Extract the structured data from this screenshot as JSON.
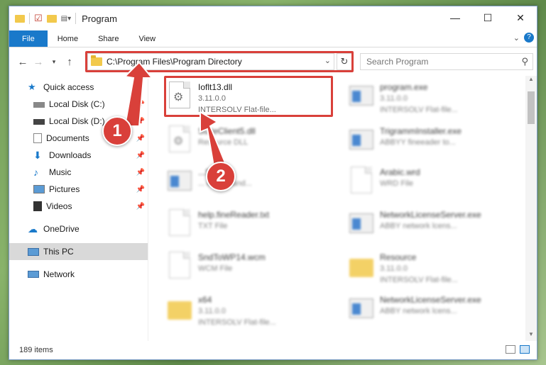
{
  "window": {
    "title": "Program",
    "controls": {
      "minimize": "—",
      "maximize": "☐",
      "close": "✕"
    }
  },
  "ribbon": {
    "tabs": [
      "File",
      "Home",
      "Share",
      "View"
    ]
  },
  "address": {
    "path": "C:\\Program Files\\Program Directory"
  },
  "search": {
    "placeholder": "Search Program"
  },
  "nav": {
    "items": [
      {
        "label": "Quick access"
      },
      {
        "label": "Local Disk (C:)"
      },
      {
        "label": "Local Disk (D:)"
      },
      {
        "label": "Documents"
      },
      {
        "label": "Downloads"
      },
      {
        "label": "Music"
      },
      {
        "label": "Pictures"
      },
      {
        "label": "Videos"
      },
      {
        "label": "OneDrive"
      },
      {
        "label": "This PC"
      },
      {
        "label": "Network"
      }
    ]
  },
  "files": [
    {
      "name": "Ioflt13.dll",
      "line2": "3.11.0.0",
      "line3": "INTERSOLV Flat-file...",
      "icon": "dll-gear-icon"
    },
    {
      "name": "program.exe",
      "line2": "3.11.0.0",
      "line3": "INTERSOLV Flat-file...",
      "icon": "exe-window-icon"
    },
    {
      "name": "StateClient5.dll",
      "line2": "Resource DLL",
      "line3": "",
      "icon": "dll-gear-icon"
    },
    {
      "name": "TrigrammInstaller.exe",
      "line2": "ABBYY fineeader to...",
      "line3": "",
      "icon": "exe-window-icon"
    },
    {
      "name": "...ST.exe",
      "line2": "... event hand...",
      "line3": "",
      "icon": "exe-window-icon"
    },
    {
      "name": "Arabic.wrd",
      "line2": "WRD File",
      "line3": "",
      "icon": "document-icon"
    },
    {
      "name": "help.fineReader.txt",
      "line2": "TXT File",
      "line3": "",
      "icon": "document-icon"
    },
    {
      "name": "NetworkLicenseServer.exe",
      "line2": "ABBY network lcens...",
      "line3": "",
      "icon": "exe-window-icon"
    },
    {
      "name": "SndToWP14.wcm",
      "line2": "WCM File",
      "line3": "",
      "icon": "document-icon"
    },
    {
      "name": "Resource",
      "line2": "3.11.0.0",
      "line3": "INTERSOLV Flat-file...",
      "icon": "folder-icon"
    },
    {
      "name": "x64",
      "line2": "3.11.0.0",
      "line3": "INTERSOLV Flat-file...",
      "icon": "folder-icon"
    },
    {
      "name": "NetworkLicenseServer.exe",
      "line2": "ABBY network lcens...",
      "line3": "",
      "icon": "exe-window-icon"
    }
  ],
  "status": {
    "count": "189 items"
  },
  "callouts": [
    "1",
    "2"
  ],
  "colors": {
    "accent": "#1979ca",
    "highlight_red": "#d9403a",
    "selected": "#d9d9d9"
  }
}
